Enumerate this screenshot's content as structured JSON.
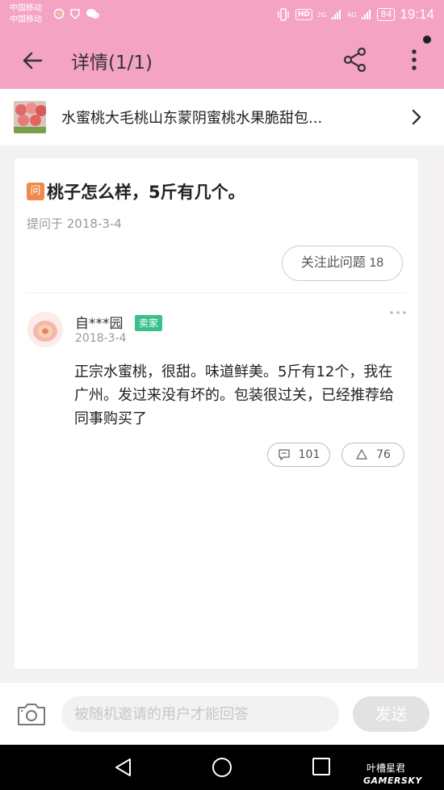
{
  "status_bar": {
    "carrier_1": "中国移动",
    "carrier_2": "中国移动",
    "hd": "HD",
    "network_1": "2G",
    "network_2": "4G",
    "battery": "84",
    "time": "19:14"
  },
  "app_bar": {
    "title": "详情(1/1)"
  },
  "product": {
    "title": "水蜜桃大毛桃山东蒙阴蜜桃水果脆甜包..."
  },
  "question": {
    "badge": "问",
    "title": "桃子怎么样，5斤有几个。",
    "date": "提问于 2018-3-4",
    "follow_label": "关注此问题 18"
  },
  "answer": {
    "user": "自***园",
    "badge": "卖家",
    "date": "2018-3-4",
    "text": "正宗水蜜桃，很甜。味道鲜美。5斤有12个，我在广州。发过来没有坏的。包装很过关，已经推荐给同事购买了",
    "comment_count": "101",
    "like_count": "76"
  },
  "reply_bar": {
    "placeholder": "被随机邀请的用户才能回答",
    "send_label": "发送"
  },
  "watermark": {
    "line1": "叶槽星君",
    "line2": "GAMERSKY"
  },
  "colors": {
    "header_pink": "#f4a3c2",
    "question_badge": "#f08a4b",
    "seller_badge": "#3cc08b"
  }
}
